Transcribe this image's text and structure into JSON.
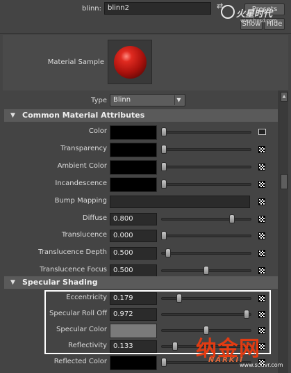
{
  "header": {
    "node_label": "blinn:",
    "node_value": "blinn2",
    "presets_label": "Presets",
    "show_label": "Show",
    "hide_label": "Hide",
    "watermark_top": "火星时代",
    "watermark_top_url": "www.hxsd.com"
  },
  "sample": {
    "label": "Material Sample"
  },
  "type_row": {
    "label": "Type",
    "value": "Blinn"
  },
  "common": {
    "title": "Common Material Attributes",
    "rows": [
      {
        "label": "Color",
        "kind": "color",
        "color": "#000000",
        "slider": 0.0,
        "icon": "map-input-icon"
      },
      {
        "label": "Transparency",
        "kind": "color",
        "color": "#000000",
        "slider": 0.0,
        "icon": "checker-icon"
      },
      {
        "label": "Ambient Color",
        "kind": "color",
        "color": "#000000",
        "slider": 0.0,
        "icon": "checker-icon"
      },
      {
        "label": "Incandescence",
        "kind": "color",
        "color": "#000000",
        "slider": 0.0,
        "icon": "checker-icon"
      },
      {
        "label": "Bump Mapping",
        "kind": "bump",
        "icon": "checker-icon"
      },
      {
        "label": "Diffuse",
        "kind": "num",
        "value": "0.800",
        "slider": 0.8,
        "icon": "checker-icon"
      },
      {
        "label": "Translucence",
        "kind": "num",
        "value": "0.000",
        "slider": 0.0,
        "icon": "checker-icon"
      },
      {
        "label": "Translucence Depth",
        "kind": "num",
        "value": "0.500",
        "slider": 0.05,
        "icon": "checker-icon"
      },
      {
        "label": "Translucence Focus",
        "kind": "num",
        "value": "0.500",
        "slider": 0.5,
        "icon": "checker-icon"
      }
    ]
  },
  "specular": {
    "title": "Specular Shading",
    "rows": [
      {
        "label": "Eccentricity",
        "kind": "num",
        "value": "0.179",
        "slider": 0.179,
        "icon": "checker-icon"
      },
      {
        "label": "Specular Roll Off",
        "kind": "num",
        "value": "0.972",
        "slider": 0.972,
        "icon": "checker-icon"
      },
      {
        "label": "Specular Color",
        "kind": "color",
        "color": "#7a7a7a",
        "slider": 0.5,
        "icon": "checker-icon"
      },
      {
        "label": "Reflectivity",
        "kind": "num",
        "value": "0.133",
        "slider": 0.133,
        "icon": "checker-icon"
      },
      {
        "label": "Reflected Color",
        "kind": "color",
        "color": "#000000",
        "slider": 0.0,
        "icon": "checker-icon"
      }
    ]
  },
  "watermark_bottom": {
    "text": "纳金网",
    "sub": "NARKII",
    "url": "www.souvr.com"
  },
  "colors": {
    "highlight_box": "#ffffff",
    "sphere": "#c8201a",
    "watermark": "#e23b12"
  }
}
